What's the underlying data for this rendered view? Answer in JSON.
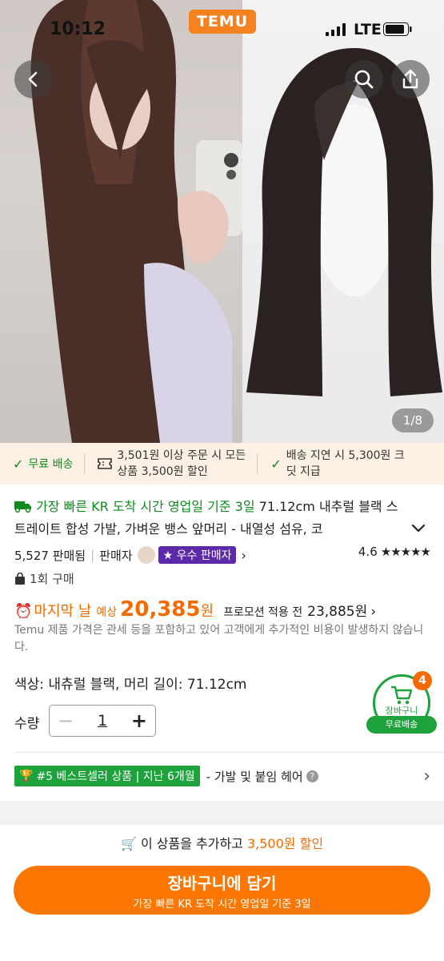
{
  "status_bar": {
    "time": "10:12",
    "network": "LTE",
    "logo": "TEMU"
  },
  "gallery": {
    "counter": "1/8"
  },
  "promo": {
    "free_shipping": "무료 배송",
    "coupon_line1": "3,501원 이상 주문 시 모든",
    "coupon_line2": "상품 3,500원 할인",
    "delay_line1": "배송 지연 시 5,300원 크",
    "delay_line2": "딧 지급"
  },
  "product": {
    "delivery_prefix": "가장 빠른 KR 도착 시간 영업일 기준 3일",
    "title": "71.12cm 내추럴 블랙 스트레이트 합성 가발, 가벼운 뱅스 앞머리 - 내열성 섬유, 코",
    "sold": "5,527 판매됨",
    "seller_label": "판매자",
    "seller_badge": "우수 판매자",
    "rating": "4.6",
    "stars": 4.6,
    "purchased": "1회 구매",
    "last_day": "마지막 날",
    "estimated": "예상",
    "price": "20,385",
    "currency": "원",
    "promo_before": "프로모션 적용 전",
    "original_price": "23,885원",
    "notice": "Temu 제품 가격은 관세 등을 포함하고 있어 고객에게 추가적인 비용이 발생하지 않습니다.",
    "spec": "색상: 내츄럴 블랙, 머리 길이: 71.12cm",
    "qty_label": "수량",
    "qty_value": "1"
  },
  "cart_float": {
    "count": "4",
    "label": "장바구니",
    "free": "무료배송"
  },
  "bestseller": {
    "badge": "#5 베스트셀러 상품 | 지난 6개월",
    "category": "- 가발 및 붙임 헤어"
  },
  "bottom": {
    "hint_prefix": "이 상품을 추가하고",
    "hint_amount": "3,500원 할인",
    "cta": "장바구니에 담기",
    "cta_sub": "가장 빠른 KR 도착 시간 영업일 기준 3일"
  },
  "colors": {
    "accent": "#fb7701",
    "green": "#1ea23c",
    "purple": "#5c2aa8"
  }
}
